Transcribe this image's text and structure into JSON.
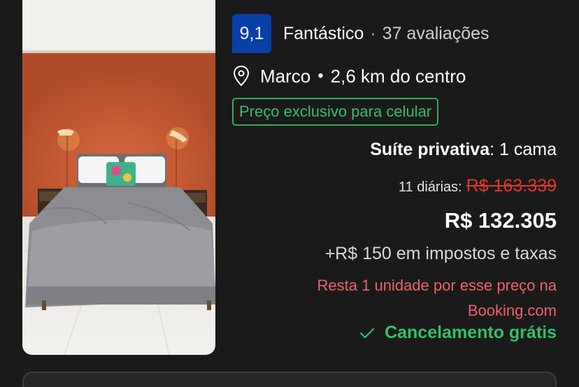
{
  "listing": {
    "photo_alt": "Quarto com parede laranja e cama de casal",
    "rating": {
      "score": "9,1",
      "label": "Fantástico",
      "separator": "·",
      "reviews": "37 avaliações"
    },
    "location": {
      "icon": "map-pin-icon",
      "neighborhood": "Marco",
      "separator": "•",
      "distance": "2,6 km do centro"
    },
    "deal_badge": "Preço exclusivo para celular",
    "room": {
      "type": "Suíte privativa",
      "beds": ": 1 cama"
    },
    "pricing": {
      "nights_label": "11 diárias:",
      "original_price": "R$ 163.339",
      "current_price": "R$ 132.305",
      "taxes": "+R$ 150 em impostos e taxas"
    },
    "scarcity": {
      "line1": "Resta 1 unidade por esse preço na",
      "line2": "Booking.com"
    },
    "cancellation": {
      "icon": "checkmark-icon",
      "text": "Cancelamento grátis"
    }
  },
  "colors": {
    "background": "#1a1a1a",
    "score_badge": "#0a3fa8",
    "green": "#34c06a",
    "red_strike": "#e2352a",
    "scarcity_red": "#f0606a"
  }
}
